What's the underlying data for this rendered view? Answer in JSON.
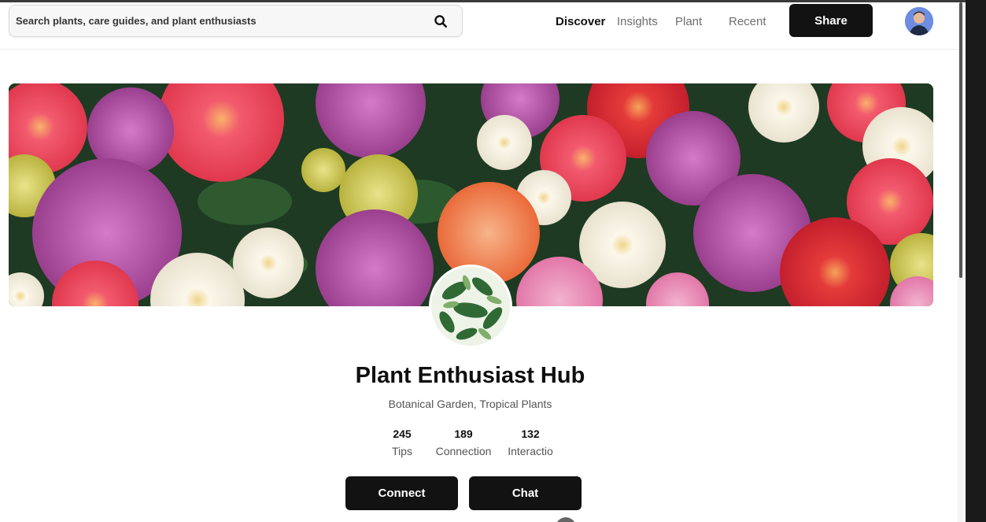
{
  "search": {
    "placeholder": "Search plants, care guides, and plant enthusiasts"
  },
  "nav": [
    {
      "label": "Discover",
      "active": true
    },
    {
      "label": "Insights",
      "active": false
    },
    {
      "label": "Plant",
      "active": false
    },
    {
      "label": "Recent",
      "active": false
    }
  ],
  "header": {
    "share_label": "Share"
  },
  "profile": {
    "name": "Plant Enthusiast Hub",
    "subtitle": "Botanical Garden, Tropical Plants"
  },
  "stats": [
    {
      "value": "245",
      "label": "Tips"
    },
    {
      "value": "189",
      "label": "Connection"
    },
    {
      "value": "132",
      "label": "Interactio"
    }
  ],
  "actions": {
    "connect_label": "Connect",
    "chat_label": "Chat"
  },
  "colors": {
    "primary": "#121212",
    "text": "#0f0f0f",
    "muted": "#555555",
    "page_bg": "#ffffff"
  }
}
